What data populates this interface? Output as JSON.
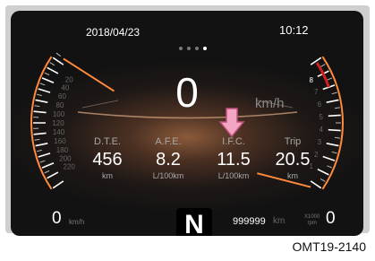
{
  "header": {
    "date": "2018/04/23",
    "time": "10:12"
  },
  "page_dots": {
    "count": 4,
    "active_index": 3
  },
  "speed": {
    "value": "0",
    "unit": "km/h"
  },
  "speedometer": {
    "ticks": [
      "220",
      "200",
      "180",
      "160",
      "140",
      "120",
      "100",
      "80",
      "60",
      "40",
      "20"
    ],
    "zero": "0",
    "unit": "km/h"
  },
  "tachometer": {
    "ticks": [
      "8",
      "7",
      "6",
      "5",
      "4",
      "3",
      "2",
      "1"
    ],
    "zero": "0",
    "unit_line1": "X1000",
    "unit_line2": "rpm",
    "redline_color": "#d21e1e"
  },
  "metrics": [
    {
      "label": "D.T.E.",
      "value": "456",
      "unit": "km"
    },
    {
      "label": "A.F.E.",
      "value": "8.2",
      "unit": "L/100km"
    },
    {
      "label": "I.F.C.",
      "value": "11.5",
      "unit": "L/100km"
    },
    {
      "label": "Trip",
      "value": "20.5",
      "unit": "km"
    }
  ],
  "gear": "N",
  "odometer": {
    "value": "999999",
    "unit": "km"
  },
  "indicator": {
    "color": "#f0a0c0",
    "points_to": "I.F.C."
  },
  "caption": "OMT19-2140",
  "colors": {
    "needle": "#ff8a3c",
    "background": "#121212",
    "accent": "#f0a0c0"
  }
}
